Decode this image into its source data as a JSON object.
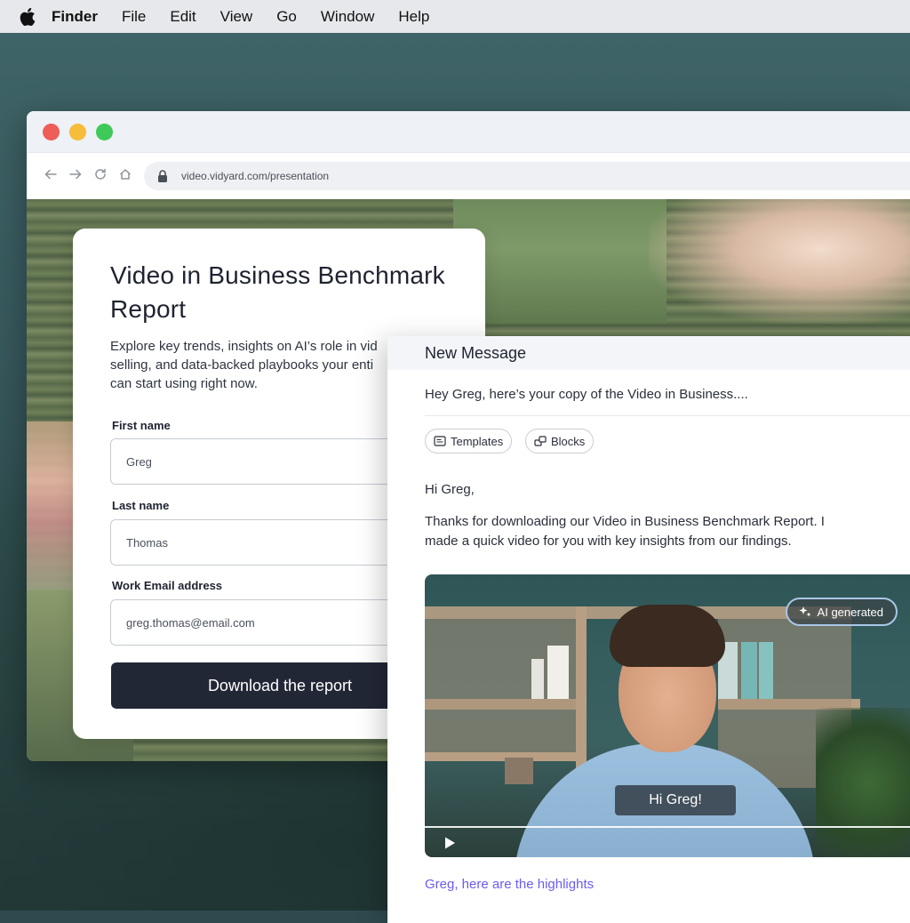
{
  "menubar": {
    "items": [
      "Finder",
      "File",
      "Edit",
      "View",
      "Go",
      "Window",
      "Help"
    ]
  },
  "browser": {
    "url": "video.vidyard.com/presentation"
  },
  "report": {
    "title": "Video in Business Benchmark Report",
    "lead": "Explore key trends, insights on AI’s role in vid\nselling, and data-backed playbooks your enti\ncan start using right now.",
    "first_name_label": "First name",
    "first_name_value": "Greg",
    "last_name_label": "Last name",
    "last_name_value": "Thomas",
    "email_label": "Work Email address",
    "email_value": "greg.thomas@email.com",
    "cta_label": "Download the report"
  },
  "compose": {
    "title": "New Message",
    "subject": "Hey Greg, here’s your copy of the Video in Business....",
    "templates_label": "Templates",
    "blocks_label": "Blocks",
    "greeting": "Hi Greg,",
    "body": "Thanks for downloading our Video in Business Benchmark Report. I\nmade a quick video for you with key insights from our findings.",
    "video": {
      "ai_badge": "AI generated",
      "caption": "Hi Greg!"
    },
    "link_text": "Greg, here are the highlights"
  },
  "colors": {
    "accent_link": "#6a5cf0",
    "cta_bg": "#222736",
    "traffic_red": "#ee5d57",
    "traffic_yellow": "#f6bd3b",
    "traffic_green": "#3fc95a"
  }
}
